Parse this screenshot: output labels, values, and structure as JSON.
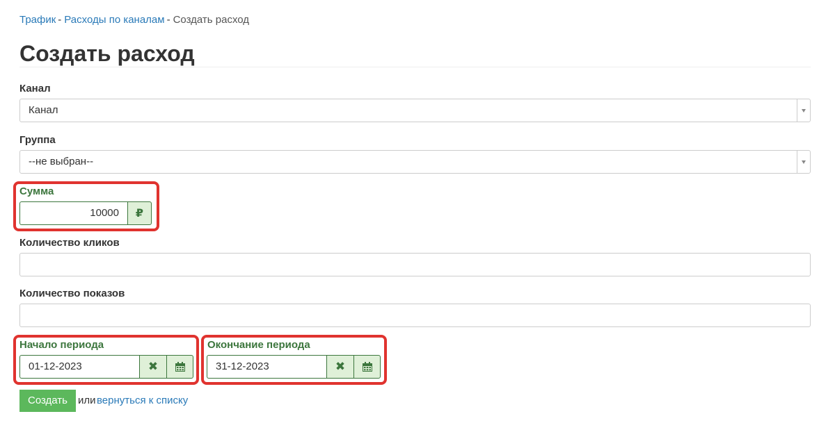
{
  "breadcrumb": {
    "items": [
      {
        "label": "Трафик",
        "sep": "-"
      },
      {
        "label": "Расходы по каналам",
        "sep": "-"
      }
    ],
    "current": "Создать расход"
  },
  "page_title": "Создать расход",
  "form": {
    "channel": {
      "label": "Канал",
      "value": "Канал"
    },
    "group": {
      "label": "Группа",
      "value": "--не выбран--"
    },
    "amount": {
      "label": "Сумма",
      "value": "10000",
      "currency_symbol": "₽"
    },
    "clicks": {
      "label": "Количество кликов",
      "value": ""
    },
    "impressions": {
      "label": "Количество показов",
      "value": ""
    },
    "period_start": {
      "label": "Начало периода",
      "value": "01-12-2023"
    },
    "period_end": {
      "label": "Окончание периода",
      "value": "31-12-2023"
    },
    "submit_label": "Создать",
    "or_text": "или",
    "back_link": "вернуться к списку"
  },
  "icons": {
    "select_arrow": "chevron-down-icon",
    "currency": "ruble-icon",
    "clear": "times-icon",
    "calendar": "calendar-icon"
  },
  "colors": {
    "link": "#2a7ab8",
    "success_text": "#3c763d",
    "success_bg": "#dff0d8",
    "submit_bg": "#5cb85c",
    "highlight": "#e0332f"
  }
}
